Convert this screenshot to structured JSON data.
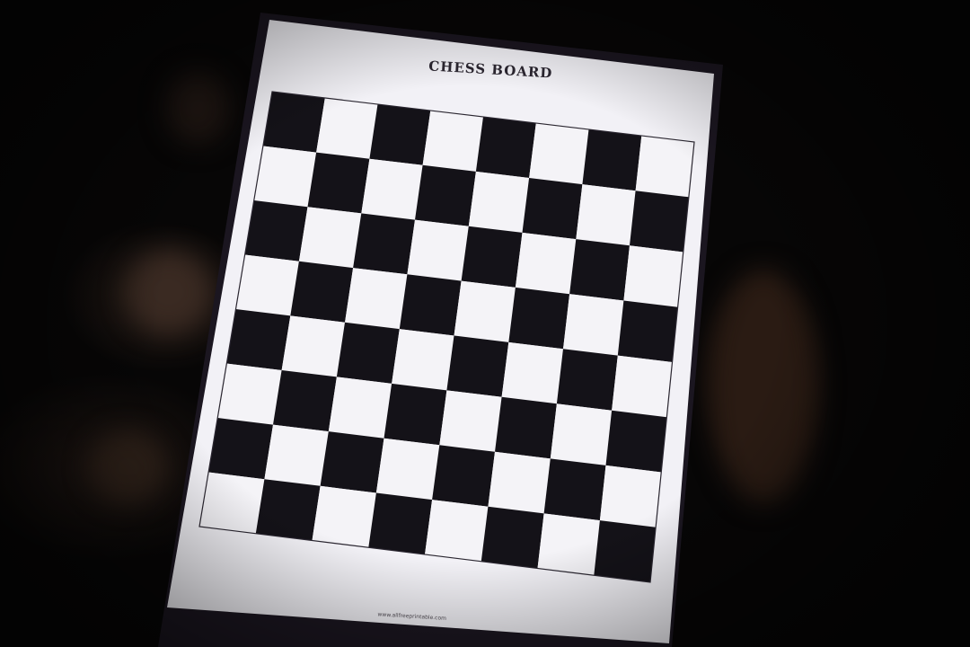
{
  "page": {
    "title": "CHESS BOARD",
    "footer_url": "www.allfreeprintable.com"
  },
  "board": {
    "rows": 8,
    "cols": 8,
    "top_left_square": "dark",
    "dark_color": "#141218",
    "light_color": "#f4f3f7"
  },
  "colors": {
    "paper": "#f2f1f6",
    "background": "#070606",
    "screen_edge": "#1b1620"
  }
}
